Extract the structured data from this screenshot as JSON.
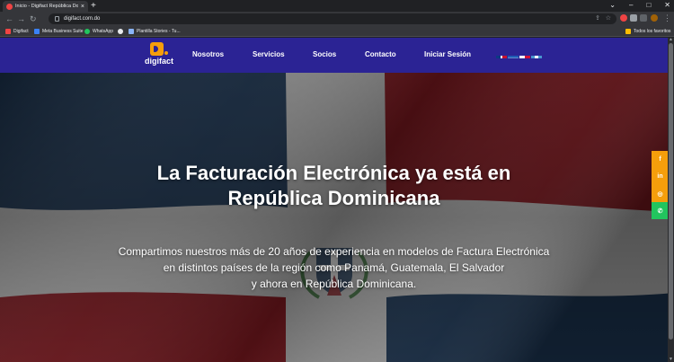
{
  "browser": {
    "tab_title": "Inicio - Digifact República Domi",
    "tab_close": "×",
    "new_tab": "+",
    "window_controls": [
      "⌄",
      "–",
      "□",
      "✕"
    ],
    "url": "digifact.com.do",
    "back": "←",
    "forward": "→",
    "reload": "↻",
    "bookmarks": [
      {
        "label": "Digifact",
        "color": "#ef4444"
      },
      {
        "label": "Meta Business Suite",
        "color": "#3b82f6"
      },
      {
        "label": "WhatsApp",
        "color": "#22c55e"
      },
      {
        "label": "",
        "color": "#e8eaed"
      },
      {
        "label": "Plantilla Stories - Tu...",
        "color": "#8ab4f8"
      }
    ],
    "all_bookmarks": "Todos los favoritos"
  },
  "site": {
    "brand": "digifact",
    "nav": [
      "Nosotros",
      "Servicios",
      "Socios",
      "Contacto",
      "Iniciar Sesión"
    ],
    "hero_title": [
      "La Facturación Electrónica ya está en",
      "República Dominicana"
    ],
    "hero_body": [
      "Compartimos nuestros más de 20 años de experiencia en modelos de Factura Electrónica",
      "en distintos países de la región como Panamá, Guatemala, El Salvador",
      "y ahora en República Dominicana."
    ],
    "social": [
      {
        "label": "f",
        "color": "#f59e0b"
      },
      {
        "label": "in",
        "color": "#f59e0b"
      },
      {
        "label": "◎",
        "color": "#f59e0b"
      },
      {
        "label": "✆",
        "color": "#22c55e"
      }
    ]
  },
  "colors": {
    "navbar": "#2b2394",
    "accent": "#f59e0b",
    "flag_blue": "#1e3a5c",
    "flag_red": "#9b1b22"
  }
}
